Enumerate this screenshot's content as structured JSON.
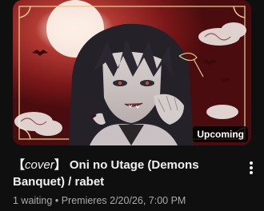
{
  "video": {
    "badge": "Upcoming",
    "title_bracket_open": "【",
    "title_cover": "cover",
    "title_bracket_close": "】",
    "title_rest": "Oni no Utage (Demons Banquet) / rabet",
    "waiting": "1 waiting",
    "separator": "•",
    "premieres": "Premieres 2/20/26, 7:00 PM",
    "menu_icon": "more-vertical-icon"
  },
  "colors": {
    "background": "#0f0f0f",
    "thumbnail_red": "#8c1d1f",
    "frame_gold": "#e9c98a",
    "secondary_text": "#aaaaaa"
  }
}
